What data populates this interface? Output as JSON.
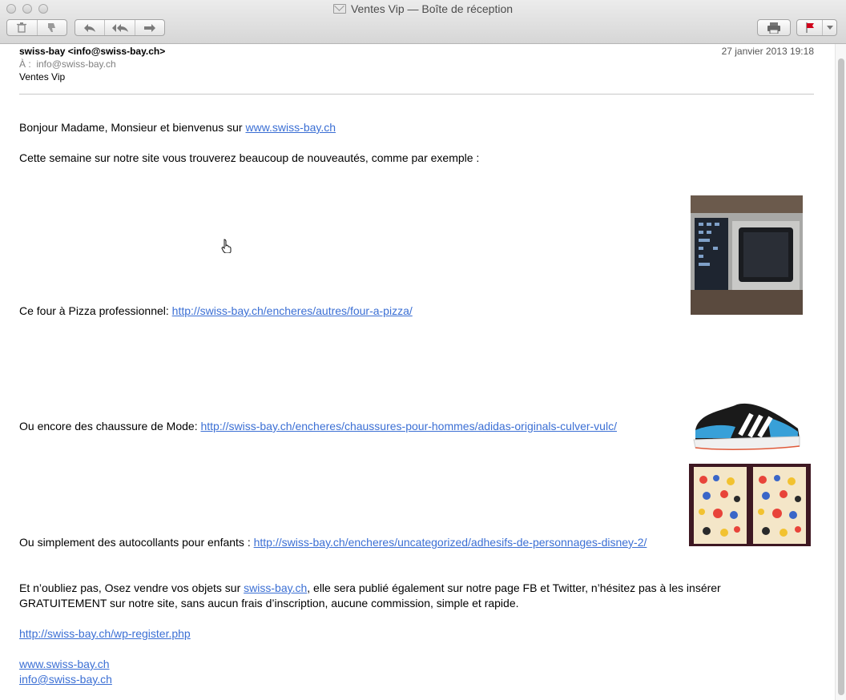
{
  "window": {
    "title": "Ventes Vip — Boîte de réception"
  },
  "toolbar": {
    "delete_icon": "trash-icon",
    "junk_icon": "thumbs-down-icon",
    "reply_icon": "reply-arrow-icon",
    "reply_all_icon": "reply-all-icon",
    "forward_icon": "forward-arrow-icon",
    "print_icon": "printer-icon",
    "flag_icon": "flag-icon",
    "flag_color": "#d0021b"
  },
  "header": {
    "from": "swiss-bay <info@swiss-bay.ch>",
    "to_label": "À :",
    "to_value": "info@swiss-bay.ch",
    "subject": "Ventes Vip",
    "date": "27 janvier 2013 19:18"
  },
  "body": {
    "greeting_text": "Bonjour Madame, Monsieur et bienvenus sur ",
    "greeting_link": "www.swiss-bay.ch",
    "intro": "Cette semaine sur notre site vous trouverez beaucoup de nouveautés, comme par exemple :",
    "item1_text": "Ce four à Pizza professionnel: ",
    "item1_link": "http://swiss-bay.ch/encheres/autres/four-a-pizza/",
    "item2_text": "Ou encore des chaussure de Mode: ",
    "item2_link": "http://swiss-bay.ch/encheres/chaussures-pour-hommes/adidas-originals-culver-vulc/",
    "item3_text": "Ou simplement des autocollants pour enfants : ",
    "item3_link": "http://swiss-bay.ch/encheres/uncategorized/adhesifs-de-personnages-disney-2/",
    "outro_a": "Et n’oubliez pas, Osez vendre vos objets sur ",
    "outro_link": "swiss-bay.ch",
    "outro_b": ", elle sera publié également sur notre page FB et Twitter, n’hésitez pas à les insérer",
    "outro_c": "GRATUITEMENT sur notre site, sans aucun frais d’inscription, aucune commission,  simple et rapide.",
    "register_link": "http://swiss-bay.ch/wp-register.php",
    "site_link": "www.swiss-bay.ch",
    "email_link": "info@swiss-bay.ch"
  },
  "images": {
    "oven": "pizza-oven-photo",
    "shoe": "sneaker-photo",
    "stickers": "sticker-sheets-photo"
  },
  "cursor_icon": "hand-pointer-icon"
}
